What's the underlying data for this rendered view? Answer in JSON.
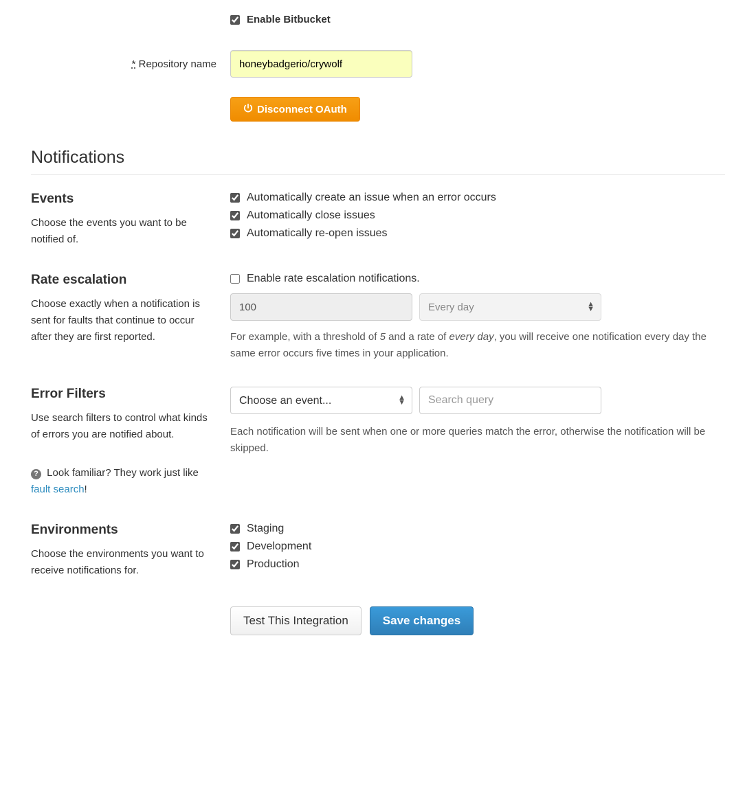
{
  "bitbucket": {
    "enable_label": "Enable Bitbucket",
    "enable_checked": true,
    "repo_label": "Repository name",
    "repo_required_mark": "*",
    "repo_value": "honeybadgerio/crywolf",
    "disconnect_label": "Disconnect OAuth"
  },
  "notifications_title": "Notifications",
  "events": {
    "title": "Events",
    "desc": "Choose the events you want to be notified of.",
    "items": [
      {
        "label": "Automatically create an issue when an error occurs",
        "checked": true
      },
      {
        "label": "Automatically close issues",
        "checked": true
      },
      {
        "label": "Automatically re-open issues",
        "checked": true
      }
    ]
  },
  "rate": {
    "title": "Rate escalation",
    "desc": "Choose exactly when a notification is sent for faults that continue to occur after they are first reported.",
    "enable_label": "Enable rate escalation notifications.",
    "enable_checked": false,
    "threshold": "100",
    "frequency": "Every day",
    "help_prefix": "For example, with a threshold of ",
    "help_em1": "5",
    "help_mid": " and a rate of ",
    "help_em2": "every day",
    "help_suffix": ", you will receive one notification every day the same error occurs five times in your application."
  },
  "filters": {
    "title": "Error Filters",
    "desc": "Use search filters to control what kinds of errors you are notified about.",
    "hint_prefix": "Look familiar? They work just like ",
    "hint_link": "fault search",
    "hint_suffix": "!",
    "select_placeholder": "Choose an event...",
    "query_placeholder": "Search query",
    "help": "Each notification will be sent when one or more queries match the error, otherwise the notification will be skipped."
  },
  "environments": {
    "title": "Environments",
    "desc": "Choose the environments you want to receive notifications for.",
    "items": [
      {
        "label": "Staging",
        "checked": true
      },
      {
        "label": "Development",
        "checked": true
      },
      {
        "label": "Production",
        "checked": true
      }
    ]
  },
  "actions": {
    "test": "Test This Integration",
    "save": "Save changes"
  }
}
